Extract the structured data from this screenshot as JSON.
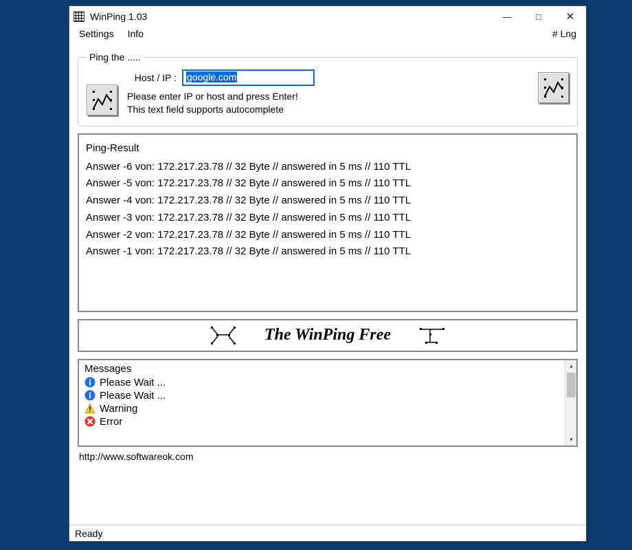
{
  "window": {
    "title": "WinPing 1.03"
  },
  "menubar": {
    "settings": "Settings",
    "info": "Info",
    "lang": "# Lng"
  },
  "groupbox": {
    "legend": "Ping the .....",
    "host_label": "Host / IP :",
    "host_value": "google.com",
    "hint_line1": "Please enter IP or host and press Enter!",
    "hint_line2": "This text field supports autocomplete"
  },
  "result": {
    "title": "Ping-Result",
    "rows": [
      "Answer -6 von: 172.217.23.78  // 32 Byte // answered in 5 ms // 110 TTL",
      "Answer -5 von: 172.217.23.78  // 32 Byte // answered in 5 ms // 110 TTL",
      "Answer -4 von: 172.217.23.78  // 32 Byte // answered in 5 ms // 110 TTL",
      "Answer -3 von: 172.217.23.78  // 32 Byte // answered in 5 ms // 110 TTL",
      "Answer -2 von: 172.217.23.78  // 32 Byte // answered in 5 ms // 110 TTL",
      "Answer -1 von: 172.217.23.78  // 32 Byte // answered in 5 ms // 110 TTL"
    ]
  },
  "banner": {
    "text": "The WinPing Free"
  },
  "messages": {
    "title": "Messages",
    "items": [
      {
        "icon": "info",
        "text": "Please Wait ..."
      },
      {
        "icon": "info",
        "text": "Please Wait ..."
      },
      {
        "icon": "warn",
        "text": "Warning"
      },
      {
        "icon": "error",
        "text": "Error"
      }
    ]
  },
  "footer": {
    "url": "http://www.softwareok.com"
  },
  "statusbar": {
    "text": "Ready"
  }
}
